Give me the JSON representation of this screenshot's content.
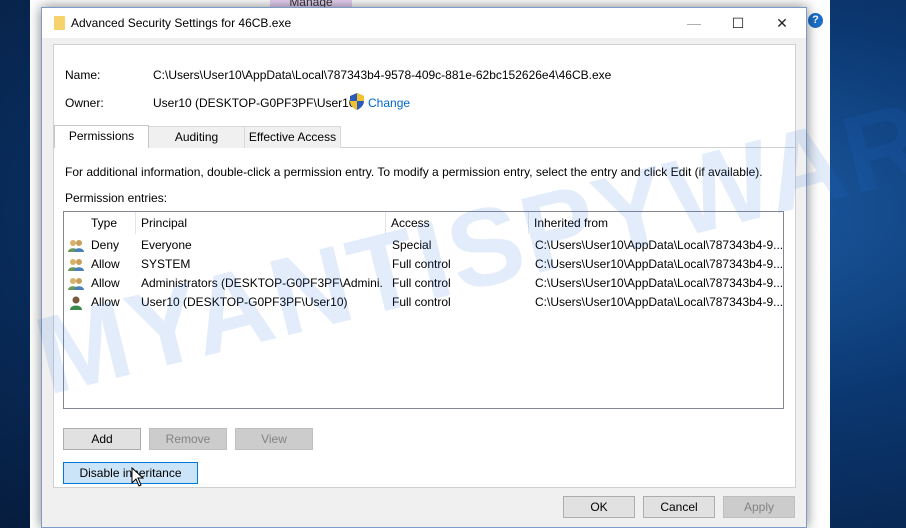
{
  "background": {
    "tab_label": "Manage",
    "help_icon": "?"
  },
  "dialog": {
    "title": "Advanced Security Settings for 46CB.exe",
    "name_label": "Name:",
    "name_value": "C:\\Users\\User10\\AppData\\Local\\787343b4-9578-409c-881e-62bc152626e4\\46CB.exe",
    "owner_label": "Owner:",
    "owner_value": "User10 (DESKTOP-G0PF3PF\\User10)",
    "change_link": "Change",
    "tabs": [
      {
        "label": "Permissions",
        "active": true
      },
      {
        "label": "Auditing"
      },
      {
        "label": "Effective Access"
      }
    ],
    "info_text": "For additional information, double-click a permission entry. To modify a permission entry, select the entry and click Edit (if available).",
    "entries_label": "Permission entries:",
    "columns": [
      "Type",
      "Principal",
      "Access",
      "Inherited from"
    ],
    "rows": [
      {
        "icon": "group-icon",
        "type": "Deny",
        "principal": "Everyone",
        "access": "Special",
        "inherited": "C:\\Users\\User10\\AppData\\Local\\787343b4-9..."
      },
      {
        "icon": "group-icon",
        "type": "Allow",
        "principal": "SYSTEM",
        "access": "Full control",
        "inherited": "C:\\Users\\User10\\AppData\\Local\\787343b4-9..."
      },
      {
        "icon": "group-icon",
        "type": "Allow",
        "principal": "Administrators (DESKTOP-G0PF3PF\\Admini...",
        "access": "Full control",
        "inherited": "C:\\Users\\User10\\AppData\\Local\\787343b4-9..."
      },
      {
        "icon": "user-icon",
        "type": "Allow",
        "principal": "User10 (DESKTOP-G0PF3PF\\User10)",
        "access": "Full control",
        "inherited": "C:\\Users\\User10\\AppData\\Local\\787343b4-9..."
      }
    ],
    "buttons": {
      "add": "Add",
      "remove": "Remove",
      "view": "View",
      "disable_inheritance": "Disable inheritance",
      "ok": "OK",
      "cancel": "Cancel",
      "apply": "Apply"
    }
  },
  "watermark": "MYANTISPYWARE.COM"
}
